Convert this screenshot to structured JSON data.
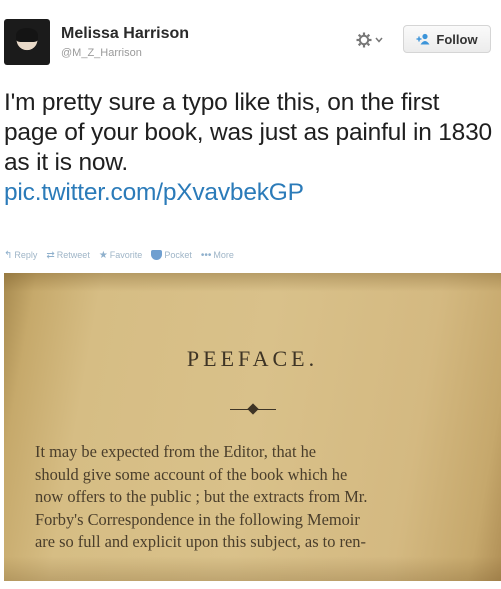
{
  "author": {
    "name": "Melissa Harrison",
    "handle": "@M_Z_Harrison"
  },
  "header": {
    "follow_label": "Follow",
    "gear_icon": "gear-icon",
    "follow_icon": "add-user-icon"
  },
  "tweet": {
    "text": "I'm pretty sure a typo like this, on the first page of your book, was just as painful in 1830 as it is now.",
    "link": "pic.twitter.com/pXvavbekGP",
    "link_color": "#2b7bb9"
  },
  "actions": [
    {
      "label": "Reply",
      "icon": "reply-icon"
    },
    {
      "label": "Retweet",
      "icon": "retweet-icon"
    },
    {
      "label": "Favorite",
      "icon": "star-icon"
    },
    {
      "label": "Pocket",
      "icon": "pocket-icon"
    },
    {
      "label": "More",
      "icon": "more-icon"
    }
  ],
  "photo": {
    "title": "PEEFACE.",
    "lines": [
      "It may be expected from the Editor, that he",
      "should give some account of the book which he",
      "now offers to the public ; but the extracts from Mr.",
      "Forby's Correspondence in the following Memoir",
      "are so full and explicit upon this subject, as to ren-"
    ]
  }
}
